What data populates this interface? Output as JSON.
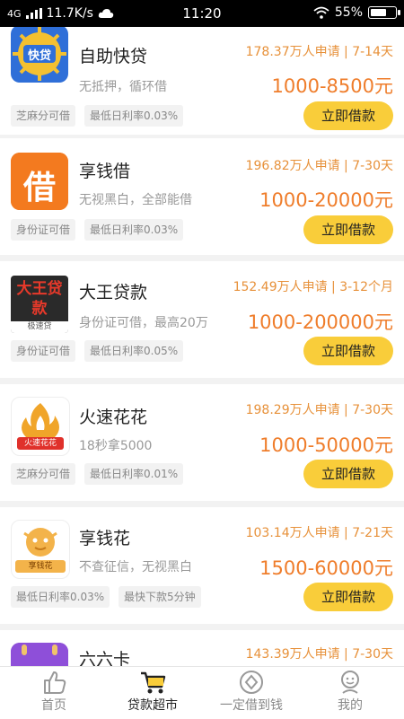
{
  "status_bar": {
    "network": "4G",
    "speed": "11.7K/s",
    "time": "11:20",
    "battery": "55%"
  },
  "loans": [
    {
      "name": "自助快贷",
      "logo_text": "快贷",
      "desc": "无抵押，循环借",
      "meta": "178.37万人申请 | 7-14天",
      "amount": "1000-8500元",
      "tags": [
        "芝麻分可借",
        "最低日利率0.03%"
      ],
      "button": "立即借款"
    },
    {
      "name": "享钱借",
      "logo_text": "借",
      "desc": "无视黑白，全部能借",
      "meta": "196.82万人申请 | 7-30天",
      "amount": "1000-20000元",
      "tags": [
        "身份证可借",
        "最低日利率0.03%"
      ],
      "button": "立即借款"
    },
    {
      "name": "大王贷款",
      "logo_text": "大王贷款",
      "logo_sub": "极速贷",
      "desc": "身份证可借，最高20万",
      "meta": "152.49万人申请 | 3-12个月",
      "amount": "1000-200000元",
      "tags": [
        "身份证可借",
        "最低日利率0.05%"
      ],
      "button": "立即借款"
    },
    {
      "name": "火速花花",
      "logo_text": "火速花花",
      "desc": "18秒拿5000",
      "meta": "198.29万人申请 | 7-30天",
      "amount": "1000-50000元",
      "tags": [
        "芝麻分可借",
        "最低日利率0.01%"
      ],
      "button": "立即借款"
    },
    {
      "name": "享钱花",
      "logo_text": "享钱花",
      "desc": "不查征信，无视黑白",
      "meta": "103.14万人申请 | 7-21天",
      "amount": "1500-60000元",
      "tags": [
        "最低日利率0.03%",
        "最快下款5分钟"
      ],
      "button": "立即借款"
    },
    {
      "name": "六六卡",
      "meta": "143.39万人申请 | 7-30天"
    }
  ],
  "tabs": [
    {
      "label": "首页",
      "icon": "thumbs-up-icon"
    },
    {
      "label": "贷款超市",
      "icon": "cart-icon"
    },
    {
      "label": "一定借到钱",
      "icon": "coin-circle-icon"
    },
    {
      "label": "我的",
      "icon": "user-icon"
    }
  ],
  "colors": {
    "accent_orange": "#ef7d2b",
    "button_yellow": "#f9cd3a",
    "meta_orange": "#e7913a"
  }
}
